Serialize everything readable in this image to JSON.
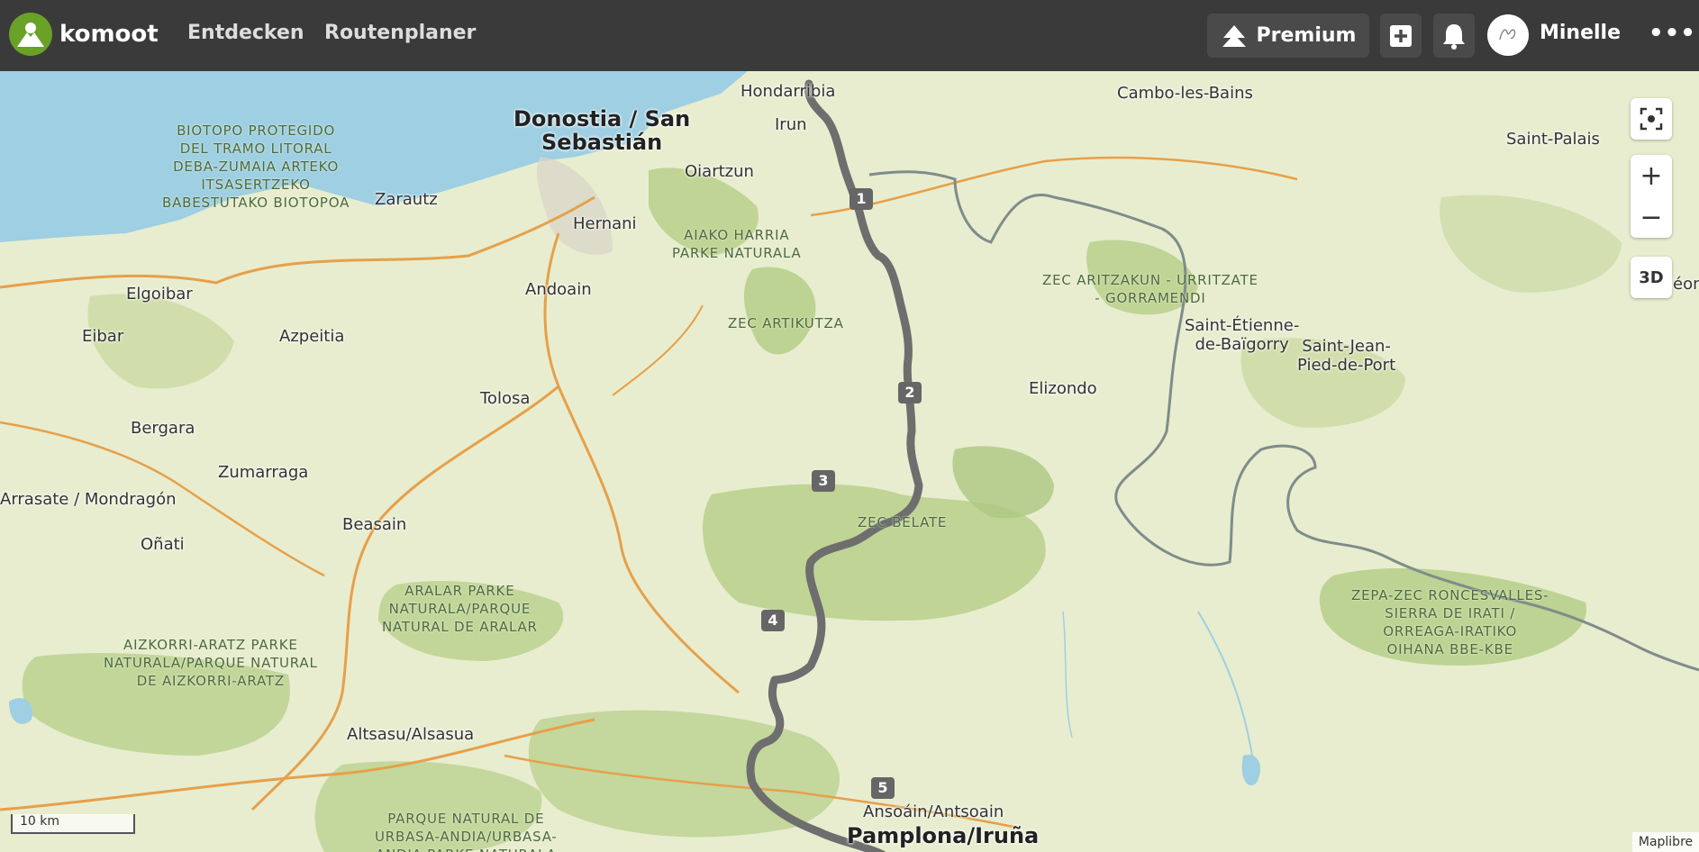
{
  "app": {
    "name": "komoot"
  },
  "nav": {
    "discover": "Entdecken",
    "planner": "Routenplaner"
  },
  "header": {
    "premium_label": "Premium",
    "user_name": "Minelle",
    "more_label": "•••"
  },
  "map_controls": {
    "3d_label": "3D",
    "zoom_in": "+",
    "zoom_out": "−"
  },
  "scale": "10 km",
  "attribution": "Maplibre",
  "places": {
    "donostia": "Donostia / San\nSebastián",
    "hondarribia": "Hondarribia",
    "irun": "Irun",
    "oiartzun": "Oiartzun",
    "zarautz": "Zarautz",
    "hernani": "Hernani",
    "andoain": "Andoain",
    "elgoibar": "Elgoibar",
    "eibar": "Eibar",
    "azpeitia": "Azpeitia",
    "tolosa": "Tolosa",
    "bergara": "Bergara",
    "zumarraga": "Zumarraga",
    "arrasate": "Arrasate / Mondragón",
    "onati": "Oñati",
    "beasain": "Beasain",
    "altsasu": "Altsasu/Alsasua",
    "ansoain": "Ansoáin/Antsoain",
    "pamplona": "Pamplona/Iruña",
    "cambo": "Cambo-les-Bains",
    "saint_palais": "Saint-Palais",
    "elizondo": "Elizondo",
    "saint_etienne": "Saint-Étienne-\nde-Baïgorry",
    "saint_jean": "Saint-Jean-\nPied-de-Port",
    "eon": "léon"
  },
  "areas": {
    "biotopo": "BIOTOPO PROTEGIDO\nDEL TRAMO LITORAL\nDEBA-ZUMAIA ARTEKO\nITSASERTZEKO\nBABESTUTAKO BIOTOPOA",
    "aiako": "AIAKO HARRIA\nPARKE NATURALA",
    "artikutza": "ZEC ARTIKUTZA",
    "aritzakun": "ZEC ARITZAKUN - URRITZATE\n- GORRAMENDI",
    "belate": "ZEC BELATE",
    "aralar": "ARALAR PARKE\nNATURALA/PARQUE\nNATURAL DE ARALAR",
    "aizkorri": "AIZKORRI-ARATZ PARKE\nNATURALA/PARQUE NATURAL\nDE AIZKORRI-ARATZ",
    "urbasa": "PARQUE NATURAL DE\nURBASA-ANDIA/URBASA-\nANDIA PARKE NATURALA",
    "roncesvalles": "ZEPA-ZEC RONCESVALLES-\nSIERRA DE IRATI /\nORREAGA-IRATIKO\nOIHANA BBE-KBE"
  },
  "waypoints": [
    "1",
    "2",
    "3",
    "4",
    "5"
  ],
  "colors": {
    "route": "#6e6e6e",
    "sea": "#9ecfe2",
    "land": "#e8edcf",
    "forest": "#b8cf8c",
    "header": "#3a3a3a",
    "brand": "#6aa127"
  }
}
